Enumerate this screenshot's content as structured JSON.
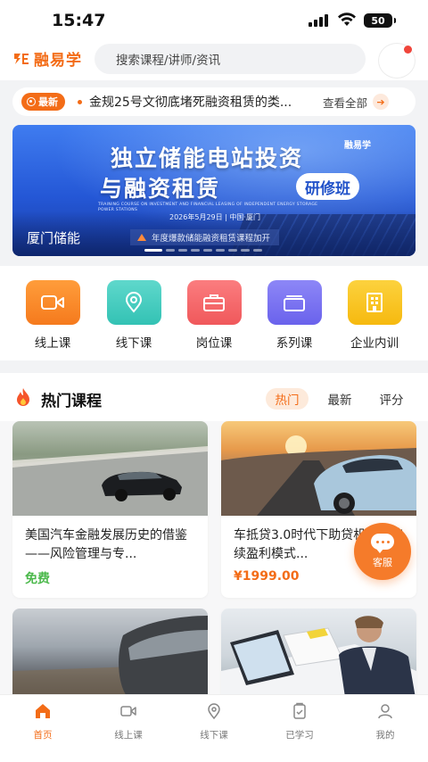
{
  "status_bar": {
    "time": "15:47",
    "battery": "50"
  },
  "header": {
    "logo_text": "融易学",
    "search_placeholder": "搜索课程/讲师/资讯"
  },
  "ticker": {
    "badge": "最新",
    "headline": "金规25号文彻底堵死融资租赁的类...",
    "more": "查看全部"
  },
  "banner": {
    "title_line1": "独立储能电站投资",
    "title_line2": "与融资租赁",
    "pill": "研修班",
    "english": "TRAINING COURSE ON INVESTMENT AND FINANCIAL LEASING OF INDEPENDENT ENERGY STORAGE POWER STATIONS",
    "date": "2026年5月29日 | 中国·厦门",
    "brand": "融易学",
    "caption": "厦门储能",
    "marquee": "年度爆款储能融资租赁课程加开",
    "slides_total": 9,
    "slide_active": 1
  },
  "categories": [
    {
      "label": "线上课",
      "icon": "video-camera-icon"
    },
    {
      "label": "线下课",
      "icon": "location-pin-icon"
    },
    {
      "label": "岗位课",
      "icon": "briefcase-icon"
    },
    {
      "label": "系列课",
      "icon": "stack-icon"
    },
    {
      "label": "企业内训",
      "icon": "building-icon"
    }
  ],
  "hot": {
    "title": "热门课程",
    "tabs": [
      "热门",
      "最新",
      "评分"
    ],
    "active_tab": 0,
    "courses": [
      {
        "title": "美国汽车金融发展历史的借鉴——风险管理与专...",
        "price": "免费",
        "image": "black-sedan-road-image"
      },
      {
        "title": "车抵贷3.0时代下助贷机构可持续盈利模式...",
        "price": "¥1999.00",
        "image": "sports-car-sunset-image"
      },
      {
        "title": "",
        "price": "",
        "image": "dark-suv-image"
      },
      {
        "title": "",
        "price": "",
        "image": "business-man-laptop-image"
      }
    ]
  },
  "fab": {
    "label": "客服"
  },
  "nav": {
    "items": [
      {
        "label": "首页",
        "icon": "home-icon"
      },
      {
        "label": "线上课",
        "icon": "video-icon"
      },
      {
        "label": "线下课",
        "icon": "location-icon"
      },
      {
        "label": "已学习",
        "icon": "clipboard-icon"
      },
      {
        "label": "我的",
        "icon": "user-icon"
      }
    ],
    "active": 0
  },
  "colors": {
    "accent": "#f36c17",
    "free_price": "#4cb94c"
  }
}
